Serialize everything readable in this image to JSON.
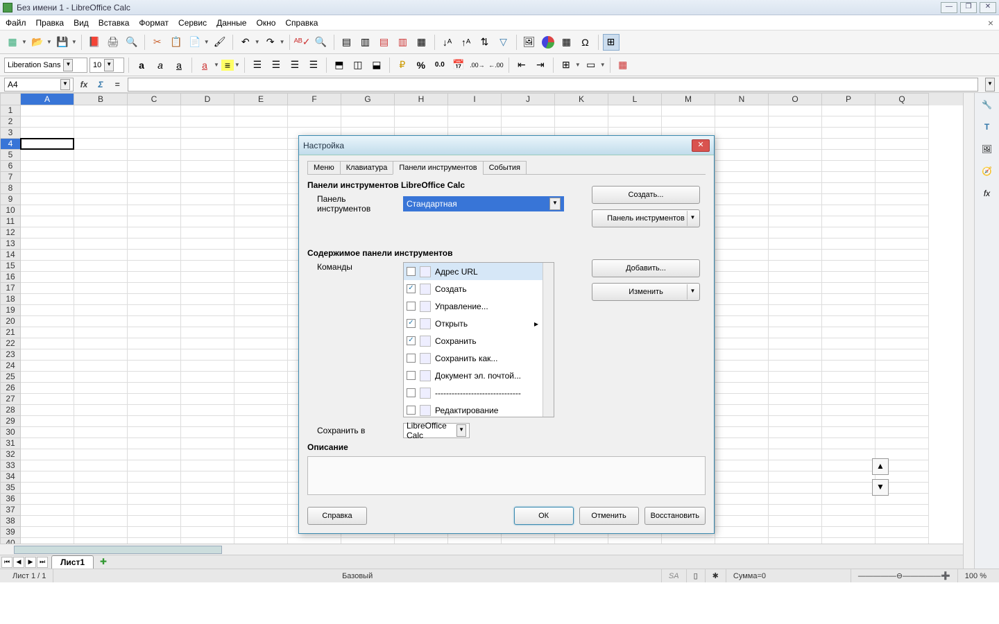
{
  "title": "Без имени 1 - LibreOffice Calc",
  "menus": [
    "Файл",
    "Правка",
    "Вид",
    "Вставка",
    "Формат",
    "Сервис",
    "Данные",
    "Окно",
    "Справка"
  ],
  "font": {
    "name": "Liberation Sans",
    "size": "10"
  },
  "cellref": "A4",
  "columns": [
    "A",
    "B",
    "C",
    "D",
    "E",
    "F",
    "G",
    "H",
    "I",
    "J",
    "K",
    "L",
    "M",
    "N",
    "O",
    "P",
    "Q"
  ],
  "sheet_tab": "Лист1",
  "status": {
    "sheet": "Лист 1 / 1",
    "style": "Базовый",
    "sum": "Сумма=0",
    "zoom": "100 %"
  },
  "dialog": {
    "title": "Настройка",
    "tabs": [
      "Меню",
      "Клавиатура",
      "Панели инструментов",
      "События"
    ],
    "active_tab": 2,
    "section1": "Панели инструментов LibreOffice Calc",
    "toolbar_label": "Панель инструментов",
    "toolbar_value": "Стандартная",
    "create_btn": "Создать...",
    "toolbar_dd": "Панель инструментов",
    "section2": "Содержимое панели инструментов",
    "commands_label": "Команды",
    "add_btn": "Добавить...",
    "modify_btn": "Изменить",
    "save_in_label": "Сохранить в",
    "save_in_value": "LibreOffice Calc",
    "desc_label": "Описание",
    "commands": [
      {
        "checked": false,
        "label": "Адрес URL",
        "sel": true
      },
      {
        "checked": true,
        "label": "Создать"
      },
      {
        "checked": false,
        "label": "Управление..."
      },
      {
        "checked": true,
        "label": "Открыть",
        "submenu": true
      },
      {
        "checked": true,
        "label": "Сохранить"
      },
      {
        "checked": false,
        "label": "Сохранить как..."
      },
      {
        "checked": false,
        "label": "Документ эл. почтой..."
      },
      {
        "checked": false,
        "label": "-------------------------------"
      },
      {
        "checked": false,
        "label": "Редактирование"
      }
    ],
    "buttons": {
      "help": "Справка",
      "ok": "ОК",
      "cancel": "Отменить",
      "reset": "Восстановить"
    }
  }
}
